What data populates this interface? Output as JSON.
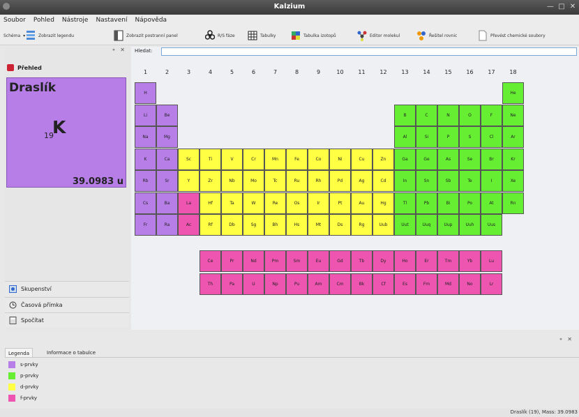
{
  "window": {
    "title": "Kalzium"
  },
  "menu": [
    "Soubor",
    "Pohled",
    "Nástroje",
    "Nastavení",
    "Nápověda"
  ],
  "toolbar": {
    "schema": "Schéma",
    "legend": "Zobrazit legendu",
    "sidepanel": "Zobrazit postranní panel",
    "rs": "R/S fáze",
    "tables": "Tabulky",
    "isotopes": "Tabulka izotopů",
    "molecule": "Editor molekul",
    "equation": "Řešitel rovnic",
    "convert": "Převést chemické soubory"
  },
  "search": {
    "label": "Hledat:",
    "value": ""
  },
  "overview": {
    "title": "Přehled",
    "element": {
      "name": "Draslík",
      "number": "19",
      "symbol": "K",
      "mass": "39.0983 u"
    }
  },
  "sidebar_tabs": [
    "Skupenství",
    "Časová přímka",
    "Spočítat"
  ],
  "groups": [
    "1",
    "2",
    "3",
    "4",
    "5",
    "6",
    "7",
    "8",
    "9",
    "10",
    "11",
    "12",
    "13",
    "14",
    "15",
    "16",
    "17",
    "18"
  ],
  "colors": {
    "s": "#b77ee8",
    "p": "#66ee33",
    "d": "#ffff44",
    "f": "#ee55b0"
  },
  "elements": [
    {
      "sym": "H",
      "row": 1,
      "col": 1,
      "block": "s"
    },
    {
      "sym": "He",
      "row": 1,
      "col": 18,
      "block": "p"
    },
    {
      "sym": "Li",
      "row": 2,
      "col": 1,
      "block": "s"
    },
    {
      "sym": "Be",
      "row": 2,
      "col": 2,
      "block": "s"
    },
    {
      "sym": "B",
      "row": 2,
      "col": 13,
      "block": "p"
    },
    {
      "sym": "C",
      "row": 2,
      "col": 14,
      "block": "p"
    },
    {
      "sym": "N",
      "row": 2,
      "col": 15,
      "block": "p"
    },
    {
      "sym": "O",
      "row": 2,
      "col": 16,
      "block": "p"
    },
    {
      "sym": "F",
      "row": 2,
      "col": 17,
      "block": "p"
    },
    {
      "sym": "Ne",
      "row": 2,
      "col": 18,
      "block": "p"
    },
    {
      "sym": "Na",
      "row": 3,
      "col": 1,
      "block": "s"
    },
    {
      "sym": "Mg",
      "row": 3,
      "col": 2,
      "block": "s"
    },
    {
      "sym": "Al",
      "row": 3,
      "col": 13,
      "block": "p"
    },
    {
      "sym": "Si",
      "row": 3,
      "col": 14,
      "block": "p"
    },
    {
      "sym": "P",
      "row": 3,
      "col": 15,
      "block": "p"
    },
    {
      "sym": "S",
      "row": 3,
      "col": 16,
      "block": "p"
    },
    {
      "sym": "Cl",
      "row": 3,
      "col": 17,
      "block": "p"
    },
    {
      "sym": "Ar",
      "row": 3,
      "col": 18,
      "block": "p"
    },
    {
      "sym": "K",
      "row": 4,
      "col": 1,
      "block": "s"
    },
    {
      "sym": "Ca",
      "row": 4,
      "col": 2,
      "block": "s"
    },
    {
      "sym": "Sc",
      "row": 4,
      "col": 3,
      "block": "d"
    },
    {
      "sym": "Ti",
      "row": 4,
      "col": 4,
      "block": "d"
    },
    {
      "sym": "V",
      "row": 4,
      "col": 5,
      "block": "d"
    },
    {
      "sym": "Cr",
      "row": 4,
      "col": 6,
      "block": "d"
    },
    {
      "sym": "Mn",
      "row": 4,
      "col": 7,
      "block": "d"
    },
    {
      "sym": "Fe",
      "row": 4,
      "col": 8,
      "block": "d"
    },
    {
      "sym": "Co",
      "row": 4,
      "col": 9,
      "block": "d"
    },
    {
      "sym": "Ni",
      "row": 4,
      "col": 10,
      "block": "d"
    },
    {
      "sym": "Cu",
      "row": 4,
      "col": 11,
      "block": "d"
    },
    {
      "sym": "Zn",
      "row": 4,
      "col": 12,
      "block": "d"
    },
    {
      "sym": "Ga",
      "row": 4,
      "col": 13,
      "block": "p"
    },
    {
      "sym": "Ge",
      "row": 4,
      "col": 14,
      "block": "p"
    },
    {
      "sym": "As",
      "row": 4,
      "col": 15,
      "block": "p"
    },
    {
      "sym": "Se",
      "row": 4,
      "col": 16,
      "block": "p"
    },
    {
      "sym": "Br",
      "row": 4,
      "col": 17,
      "block": "p"
    },
    {
      "sym": "Kr",
      "row": 4,
      "col": 18,
      "block": "p"
    },
    {
      "sym": "Rb",
      "row": 5,
      "col": 1,
      "block": "s"
    },
    {
      "sym": "Sr",
      "row": 5,
      "col": 2,
      "block": "s"
    },
    {
      "sym": "Y",
      "row": 5,
      "col": 3,
      "block": "d"
    },
    {
      "sym": "Zr",
      "row": 5,
      "col": 4,
      "block": "d"
    },
    {
      "sym": "Nb",
      "row": 5,
      "col": 5,
      "block": "d"
    },
    {
      "sym": "Mo",
      "row": 5,
      "col": 6,
      "block": "d"
    },
    {
      "sym": "Tc",
      "row": 5,
      "col": 7,
      "block": "d"
    },
    {
      "sym": "Ru",
      "row": 5,
      "col": 8,
      "block": "d"
    },
    {
      "sym": "Rh",
      "row": 5,
      "col": 9,
      "block": "d"
    },
    {
      "sym": "Pd",
      "row": 5,
      "col": 10,
      "block": "d"
    },
    {
      "sym": "Ag",
      "row": 5,
      "col": 11,
      "block": "d"
    },
    {
      "sym": "Cd",
      "row": 5,
      "col": 12,
      "block": "d"
    },
    {
      "sym": "In",
      "row": 5,
      "col": 13,
      "block": "p"
    },
    {
      "sym": "Sn",
      "row": 5,
      "col": 14,
      "block": "p"
    },
    {
      "sym": "Sb",
      "row": 5,
      "col": 15,
      "block": "p"
    },
    {
      "sym": "Te",
      "row": 5,
      "col": 16,
      "block": "p"
    },
    {
      "sym": "I",
      "row": 5,
      "col": 17,
      "block": "p"
    },
    {
      "sym": "Xe",
      "row": 5,
      "col": 18,
      "block": "p"
    },
    {
      "sym": "Cs",
      "row": 6,
      "col": 1,
      "block": "s"
    },
    {
      "sym": "Ba",
      "row": 6,
      "col": 2,
      "block": "s"
    },
    {
      "sym": "La",
      "row": 6,
      "col": 3,
      "block": "f"
    },
    {
      "sym": "Hf",
      "row": 6,
      "col": 4,
      "block": "d"
    },
    {
      "sym": "Ta",
      "row": 6,
      "col": 5,
      "block": "d"
    },
    {
      "sym": "W",
      "row": 6,
      "col": 6,
      "block": "d"
    },
    {
      "sym": "Re",
      "row": 6,
      "col": 7,
      "block": "d"
    },
    {
      "sym": "Os",
      "row": 6,
      "col": 8,
      "block": "d"
    },
    {
      "sym": "Ir",
      "row": 6,
      "col": 9,
      "block": "d"
    },
    {
      "sym": "Pt",
      "row": 6,
      "col": 10,
      "block": "d"
    },
    {
      "sym": "Au",
      "row": 6,
      "col": 11,
      "block": "d"
    },
    {
      "sym": "Hg",
      "row": 6,
      "col": 12,
      "block": "d"
    },
    {
      "sym": "Tl",
      "row": 6,
      "col": 13,
      "block": "p"
    },
    {
      "sym": "Pb",
      "row": 6,
      "col": 14,
      "block": "p"
    },
    {
      "sym": "Bi",
      "row": 6,
      "col": 15,
      "block": "p"
    },
    {
      "sym": "Po",
      "row": 6,
      "col": 16,
      "block": "p"
    },
    {
      "sym": "At",
      "row": 6,
      "col": 17,
      "block": "p"
    },
    {
      "sym": "Rn",
      "row": 6,
      "col": 18,
      "block": "p"
    },
    {
      "sym": "Fr",
      "row": 7,
      "col": 1,
      "block": "s"
    },
    {
      "sym": "Ra",
      "row": 7,
      "col": 2,
      "block": "s"
    },
    {
      "sym": "Ac",
      "row": 7,
      "col": 3,
      "block": "f"
    },
    {
      "sym": "Rf",
      "row": 7,
      "col": 4,
      "block": "d"
    },
    {
      "sym": "Db",
      "row": 7,
      "col": 5,
      "block": "d"
    },
    {
      "sym": "Sg",
      "row": 7,
      "col": 6,
      "block": "d"
    },
    {
      "sym": "Bh",
      "row": 7,
      "col": 7,
      "block": "d"
    },
    {
      "sym": "Hs",
      "row": 7,
      "col": 8,
      "block": "d"
    },
    {
      "sym": "Mt",
      "row": 7,
      "col": 9,
      "block": "d"
    },
    {
      "sym": "Ds",
      "row": 7,
      "col": 10,
      "block": "d"
    },
    {
      "sym": "Rg",
      "row": 7,
      "col": 11,
      "block": "d"
    },
    {
      "sym": "Uub",
      "row": 7,
      "col": 12,
      "block": "d"
    },
    {
      "sym": "Uut",
      "row": 7,
      "col": 13,
      "block": "p"
    },
    {
      "sym": "Uuq",
      "row": 7,
      "col": 14,
      "block": "p"
    },
    {
      "sym": "Uup",
      "row": 7,
      "col": 15,
      "block": "p"
    },
    {
      "sym": "Uuh",
      "row": 7,
      "col": 16,
      "block": "p"
    },
    {
      "sym": "Uus",
      "row": 7,
      "col": 17,
      "block": "p"
    },
    {
      "sym": "Ce",
      "row": 9,
      "col": 4,
      "block": "f"
    },
    {
      "sym": "Pr",
      "row": 9,
      "col": 5,
      "block": "f"
    },
    {
      "sym": "Nd",
      "row": 9,
      "col": 6,
      "block": "f"
    },
    {
      "sym": "Pm",
      "row": 9,
      "col": 7,
      "block": "f"
    },
    {
      "sym": "Sm",
      "row": 9,
      "col": 8,
      "block": "f"
    },
    {
      "sym": "Eu",
      "row": 9,
      "col": 9,
      "block": "f"
    },
    {
      "sym": "Gd",
      "row": 9,
      "col": 10,
      "block": "f"
    },
    {
      "sym": "Tb",
      "row": 9,
      "col": 11,
      "block": "f"
    },
    {
      "sym": "Dy",
      "row": 9,
      "col": 12,
      "block": "f"
    },
    {
      "sym": "Ho",
      "row": 9,
      "col": 13,
      "block": "f"
    },
    {
      "sym": "Er",
      "row": 9,
      "col": 14,
      "block": "f"
    },
    {
      "sym": "Tm",
      "row": 9,
      "col": 15,
      "block": "f"
    },
    {
      "sym": "Yb",
      "row": 9,
      "col": 16,
      "block": "f"
    },
    {
      "sym": "Lu",
      "row": 9,
      "col": 17,
      "block": "f"
    },
    {
      "sym": "Th",
      "row": 10,
      "col": 4,
      "block": "f"
    },
    {
      "sym": "Pa",
      "row": 10,
      "col": 5,
      "block": "f"
    },
    {
      "sym": "U",
      "row": 10,
      "col": 6,
      "block": "f"
    },
    {
      "sym": "Np",
      "row": 10,
      "col": 7,
      "block": "f"
    },
    {
      "sym": "Pu",
      "row": 10,
      "col": 8,
      "block": "f"
    },
    {
      "sym": "Am",
      "row": 10,
      "col": 9,
      "block": "f"
    },
    {
      "sym": "Cm",
      "row": 10,
      "col": 10,
      "block": "f"
    },
    {
      "sym": "Bk",
      "row": 10,
      "col": 11,
      "block": "f"
    },
    {
      "sym": "Cf",
      "row": 10,
      "col": 12,
      "block": "f"
    },
    {
      "sym": "Es",
      "row": 10,
      "col": 13,
      "block": "f"
    },
    {
      "sym": "Fm",
      "row": 10,
      "col": 14,
      "block": "f"
    },
    {
      "sym": "Md",
      "row": 10,
      "col": 15,
      "block": "f"
    },
    {
      "sym": "No",
      "row": 10,
      "col": 16,
      "block": "f"
    },
    {
      "sym": "Lr",
      "row": 10,
      "col": 17,
      "block": "f"
    }
  ],
  "legend": {
    "tabs": [
      "Legenda",
      "Informace o tabulce"
    ],
    "items": [
      {
        "label": "s-prvky",
        "color": "#b77ee8"
      },
      {
        "label": "p-prvky",
        "color": "#66ee33"
      },
      {
        "label": "d-prvky",
        "color": "#ffff44"
      },
      {
        "label": "f-prvky",
        "color": "#ee55b0"
      }
    ]
  },
  "status": "Draslík (19), Mass: 39.0983"
}
